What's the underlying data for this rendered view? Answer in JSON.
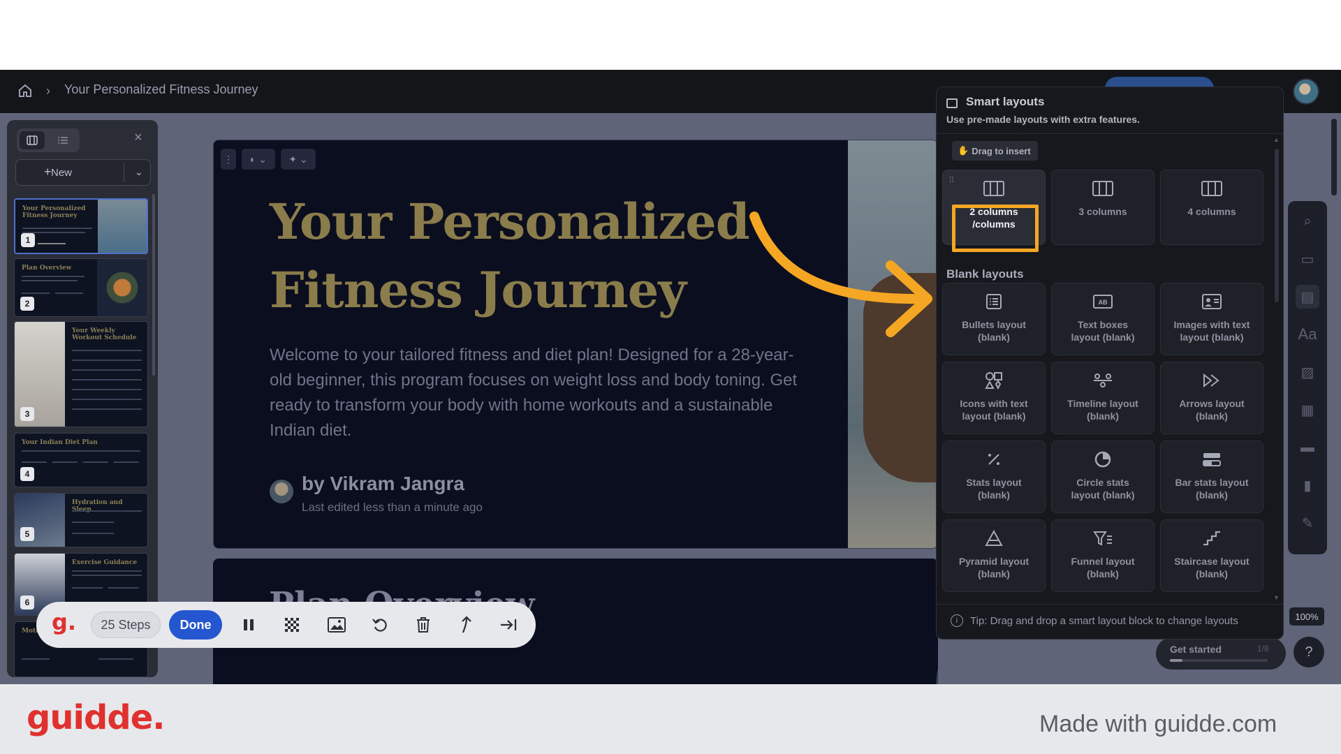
{
  "breadcrumb": {
    "title": "Your Personalized Fitness Journey"
  },
  "left_panel": {
    "new_label": "New",
    "thumbnails": [
      {
        "num": "1",
        "title": "Your Personalized Fitness Journey"
      },
      {
        "num": "2",
        "title": "Plan Overview"
      },
      {
        "num": "3",
        "title": "Your Weekly Workout Schedule"
      },
      {
        "num": "4",
        "title": "Your Indian Diet Plan"
      },
      {
        "num": "5",
        "title": "Hydration and Sleep"
      },
      {
        "num": "6",
        "title": "Exercise Guidance"
      },
      {
        "num": "",
        "title": "Motiva"
      }
    ]
  },
  "slide": {
    "title": "Your Personalized Fitness Journey",
    "body": "Welcome to your tailored fitness and diet plan! Designed for a 28-year-old beginner, this program focuses on weight loss and body toning. Get ready to transform your body with home workouts and a sustainable Indian diet.",
    "author": "by Vikram Jangra",
    "edited": "Last edited less than a minute ago"
  },
  "slide2": {
    "title": "Plan Overview"
  },
  "smart_layouts": {
    "title": "Smart layouts",
    "subtitle": "Use pre-made layouts with extra features.",
    "drag_hint": "Drag to insert",
    "columns": [
      {
        "label": "2 columns\n/columns",
        "icon": "columns-icon"
      },
      {
        "label": "3 columns",
        "icon": "columns-icon"
      },
      {
        "label": "4 columns",
        "icon": "columns-icon"
      }
    ],
    "blank_header": "Blank layouts",
    "blank": [
      {
        "label": "Bullets layout\n(blank)",
        "icon": "bullets-icon"
      },
      {
        "label": "Text boxes\nlayout (blank)",
        "icon": "text-boxes-icon"
      },
      {
        "label": "Images with text\nlayout (blank)",
        "icon": "image-text-icon"
      },
      {
        "label": "Icons with text\nlayout (blank)",
        "icon": "icons-text-icon"
      },
      {
        "label": "Timeline layout\n(blank)",
        "icon": "timeline-icon"
      },
      {
        "label": "Arrows layout\n(blank)",
        "icon": "arrows-icon"
      },
      {
        "label": "Stats layout\n(blank)",
        "icon": "stats-icon"
      },
      {
        "label": "Circle stats\nlayout (blank)",
        "icon": "circle-stats-icon"
      },
      {
        "label": "Bar stats layout\n(blank)",
        "icon": "bar-stats-icon"
      },
      {
        "label": "Pyramid layout\n(blank)",
        "icon": "pyramid-icon"
      },
      {
        "label": "Funnel layout\n(blank)",
        "icon": "funnel-icon"
      },
      {
        "label": "Staircase layout\n(blank)",
        "icon": "staircase-icon"
      }
    ],
    "tip": "Tip: Drag and drop a smart layout block to change layouts"
  },
  "zoom": "100%",
  "get_started": {
    "label": "Get started",
    "count": "1/8",
    "progress": 0.125
  },
  "recorder": {
    "steps": "25 Steps",
    "done": "Done"
  },
  "footer": {
    "brand": "guidde.",
    "made_with": "Made with guidde.com"
  },
  "colors": {
    "highlight": "#f5a623",
    "accent_blue": "#2456cf",
    "brand_red": "#e0312f"
  }
}
